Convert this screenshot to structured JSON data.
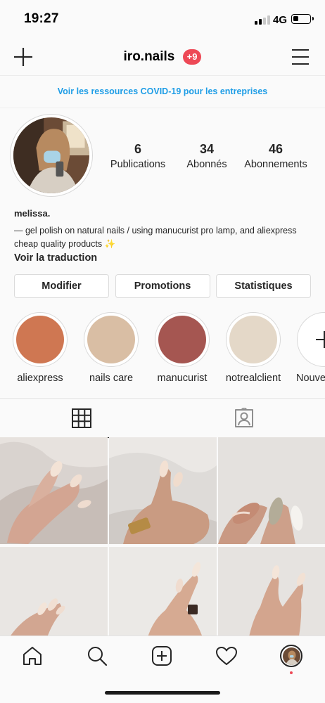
{
  "status_bar": {
    "time": "19:27",
    "network": "4G",
    "battery_level": 0.35
  },
  "header": {
    "username": "iro.nails",
    "notification_badge": "+9"
  },
  "banner": {
    "text": "Voir les ressources COVID-19 pour les entreprises"
  },
  "profile": {
    "stats": [
      {
        "value": "6",
        "label": "Publications"
      },
      {
        "value": "34",
        "label": "Abonnés"
      },
      {
        "value": "46",
        "label": "Abonnements"
      }
    ],
    "display_name": "melissa.",
    "bio": "— gel polish on natural nails / using manucurist pro lamp, and aliexpress cheap quality products ✨",
    "translate_link": "Voir la traduction"
  },
  "actions": {
    "edit": "Modifier",
    "promotions": "Promotions",
    "insights": "Statistiques"
  },
  "highlights": [
    {
      "label": "aliexpress",
      "color": "#cf7752"
    },
    {
      "label": "nails care",
      "color": "#d9bea4"
    },
    {
      "label": "manucurist",
      "color": "#a55651"
    },
    {
      "label": "notrealclient",
      "color": "#e4d8c8"
    },
    {
      "label": "Nouveau",
      "color": "#ffffff"
    }
  ],
  "colors": {
    "link_blue": "#1e9de6",
    "badge_red": "#ed4956",
    "text": "#262626"
  },
  "icons": {
    "top_left": "plus-icon",
    "top_right": "menu-icon",
    "tab_grid": "grid-icon",
    "tab_tagged": "tagged-icon",
    "nav": [
      "home-icon",
      "search-icon",
      "add-post-icon",
      "heart-icon",
      "profile-avatar"
    ]
  }
}
